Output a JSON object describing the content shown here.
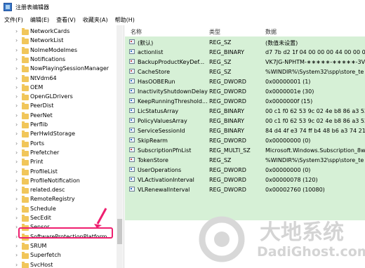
{
  "title": "注册表编辑器",
  "menu": [
    "文件(F)",
    "编辑(E)",
    "查看(V)",
    "收藏夹(A)",
    "帮助(H)"
  ],
  "tree": {
    "items": [
      "NetworkCards",
      "NetworkList",
      "NoImeModeImes",
      "Notifications",
      "NowPlayingSessionManager",
      "NtVdm64",
      "OEM",
      "OpenGLDrivers",
      "PeerDist",
      "PeerNet",
      "Perflib",
      "PerHwIdStorage",
      "Ports",
      "Prefetcher",
      "Print",
      "ProfileList",
      "ProfileNotification",
      "related.desc",
      "RemoteRegistry",
      "Schedule",
      "SecEdit",
      "Sensor",
      "SoftwareProtectionPlatform",
      "SRUM",
      "Superfetch",
      "SvcHost"
    ],
    "selected": "SoftwareProtectionPlatform"
  },
  "list": {
    "headers": [
      "名称",
      "类型",
      "数据"
    ],
    "rows": [
      {
        "name": "(默认)",
        "type": "REG_SZ",
        "data": "(数值未设置)",
        "icon": "string"
      },
      {
        "name": "actionlist",
        "type": "REG_BINARY",
        "data": "d7 7b d2 1f 04 00 00 00 44 00 00 00",
        "icon": "binary"
      },
      {
        "name": "BackupProductKeyDef...",
        "type": "REG_SZ",
        "data": "VK7JG-NPHTM-∗∗∗∗∗-∗∗∗∗∗-3V66",
        "icon": "string"
      },
      {
        "name": "CacheStore",
        "type": "REG_SZ",
        "data": "%WINDIR%\\System32\\spp\\store_te",
        "icon": "string"
      },
      {
        "name": "HasOOBERun",
        "type": "REG_DWORD",
        "data": "0x00000001 (1)",
        "icon": "binary"
      },
      {
        "name": "InactivityShutdownDelay",
        "type": "REG_DWORD",
        "data": "0x0000001e (30)",
        "icon": "binary"
      },
      {
        "name": "KeepRunningThreshold...",
        "type": "REG_DWORD",
        "data": "0x0000000f (15)",
        "icon": "binary"
      },
      {
        "name": "LicStatusArray",
        "type": "REG_BINARY",
        "data": "00 c1 f0 62 53 9c 02 4e b8 86 a3 52",
        "icon": "binary"
      },
      {
        "name": "PolicyValuesArray",
        "type": "REG_BINARY",
        "data": "00 c1 f0 62 53 9c 02 4e b8 86 a3 52",
        "icon": "binary"
      },
      {
        "name": "ServiceSessionId",
        "type": "REG_BINARY",
        "data": "84 d4 4f e3 74 ff b4 48 b6 a3 74 21",
        "icon": "binary"
      },
      {
        "name": "SkipRearm",
        "type": "REG_DWORD",
        "data": "0x00000000 (0)",
        "icon": "binary"
      },
      {
        "name": "SubscriptionPfnList",
        "type": "REG_MULTI_SZ",
        "data": "Microsoft.Windows.Subscription_8w",
        "icon": "string"
      },
      {
        "name": "TokenStore",
        "type": "REG_SZ",
        "data": "%WINDIR%\\System32\\spp\\store_te",
        "icon": "string"
      },
      {
        "name": "UserOperations",
        "type": "REG_DWORD",
        "data": "0x00000000 (0)",
        "icon": "binary"
      },
      {
        "name": "VLActivationInterval",
        "type": "REG_DWORD",
        "data": "0x00000078 (120)",
        "icon": "binary"
      },
      {
        "name": "VLRenewalInterval",
        "type": "REG_DWORD",
        "data": "0x00002760 (10080)",
        "icon": "binary"
      }
    ]
  },
  "watermark": {
    "text": "大地系统",
    "url": "DadiGhost.com"
  },
  "colors": {
    "highlight": "#ee1f6f",
    "list_bg": "#d6f0d6",
    "folder": "#f1c65a"
  }
}
